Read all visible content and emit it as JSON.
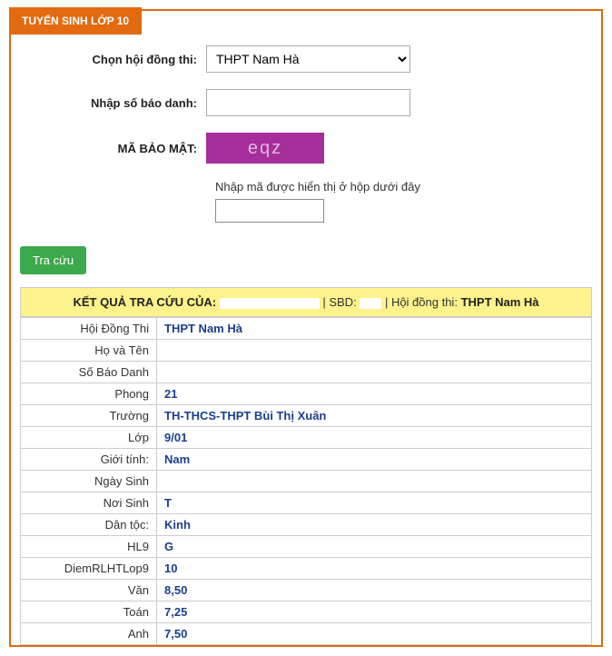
{
  "tab_title": "TUYỂN SINH LỚP 10",
  "form": {
    "council_label": "Chọn hội đồng thi:",
    "council_value": "THPT Nam Hà",
    "sbd_label": "Nhập số báo danh:",
    "sbd_value": "",
    "captcha_label": "MÃ BẢO MẬT:",
    "captcha_text": "eqz",
    "captcha_hint": "Nhập mã được hiển thị ở hộp dưới đây",
    "captcha_input": ""
  },
  "search_button": "Tra cứu",
  "result_header": {
    "prefix": "KẾT QUẢ TRA CỨU CỦA:",
    "name_redacted": "—————",
    "sbd_label": "SBD:",
    "sbd_redacted": "—",
    "council_label": "Hội đồng thi:",
    "council": "THPT Nam Hà"
  },
  "rows": [
    {
      "k": "Hội Đồng Thi",
      "v": "THPT Nam Hà"
    },
    {
      "k": "Họ và Tên",
      "v": ""
    },
    {
      "k": "Số Báo Danh",
      "v": ""
    },
    {
      "k": "Phong",
      "v": "21"
    },
    {
      "k": "Trường",
      "v": "TH-THCS-THPT Bùi Thị Xuân"
    },
    {
      "k": "Lớp",
      "v": "9/01"
    },
    {
      "k": "Giới tính:",
      "v": "Nam"
    },
    {
      "k": "Ngày Sinh",
      "v": ""
    },
    {
      "k": "Nơi Sinh",
      "v": "T"
    },
    {
      "k": "Dân tộc:",
      "v": "Kinh"
    },
    {
      "k": "HL9",
      "v": "G"
    },
    {
      "k": "DiemRLHTLop9",
      "v": "10"
    },
    {
      "k": "Văn",
      "v": "8,50"
    },
    {
      "k": "Toán",
      "v": "7,25"
    },
    {
      "k": "Anh",
      "v": "7,50"
    }
  ]
}
